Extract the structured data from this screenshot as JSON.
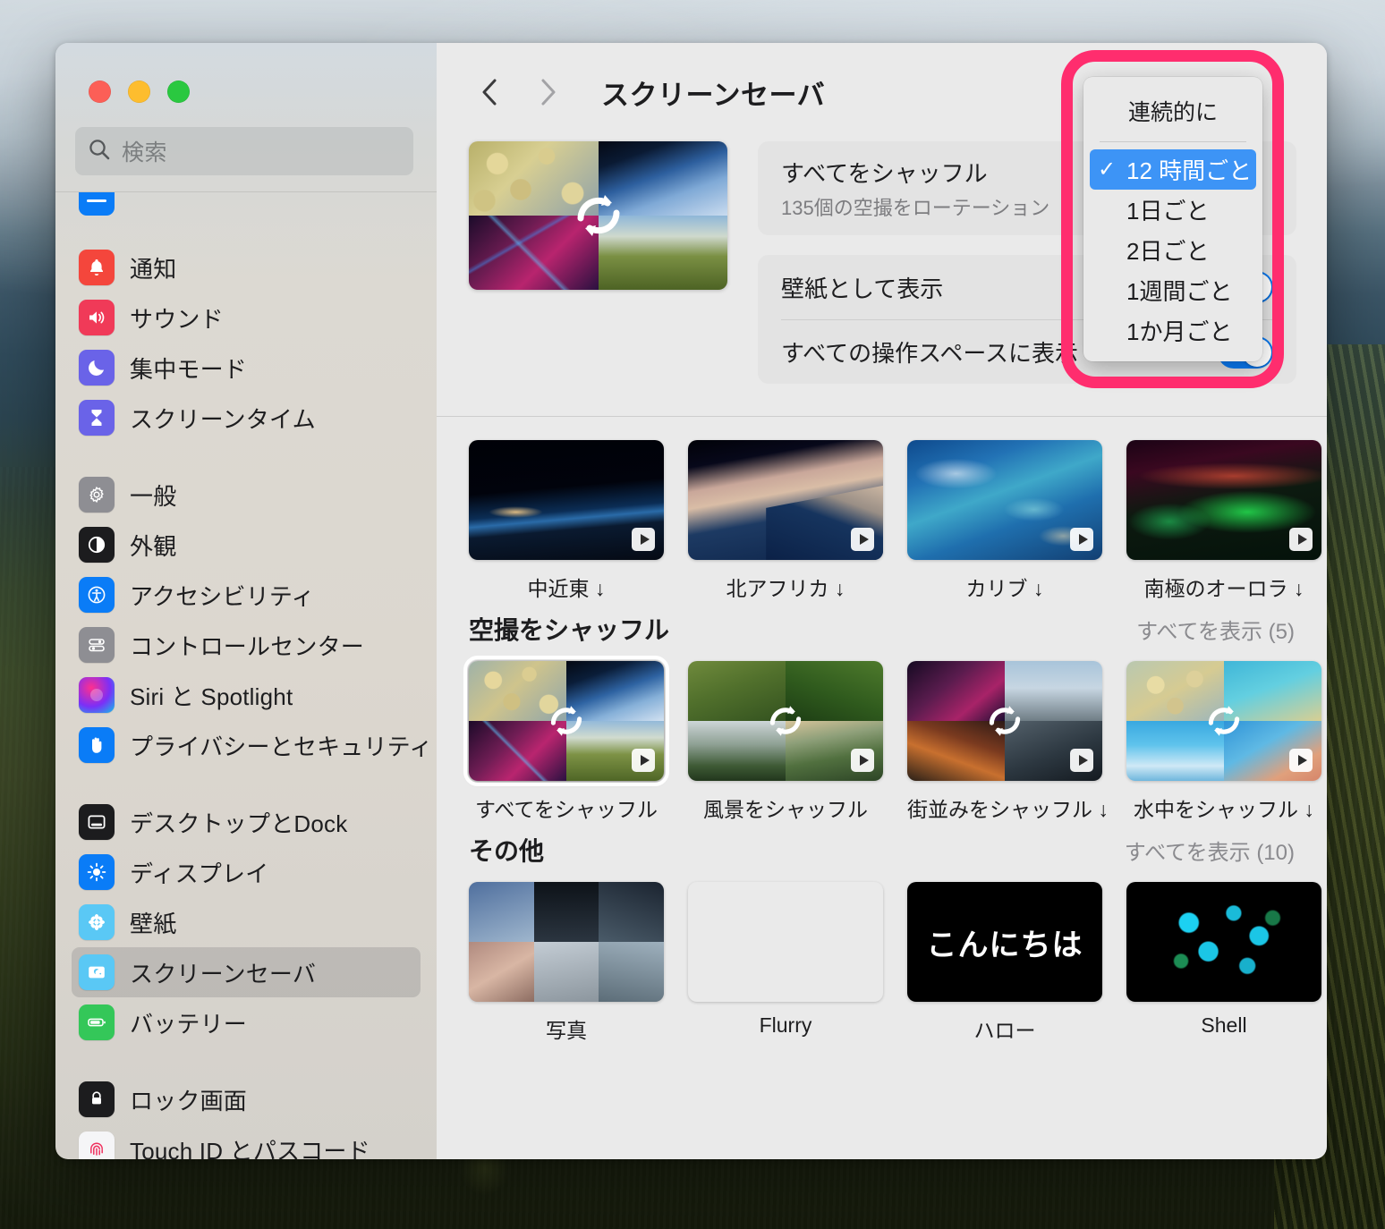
{
  "window": {
    "traffic_lights": [
      "close",
      "minimize",
      "zoom"
    ],
    "title": "スクリーンセーバ"
  },
  "search": {
    "placeholder": "検索",
    "icon": "search-icon"
  },
  "sidebar": {
    "groups": [
      {
        "items": [
          {
            "label": "通知",
            "icon": "bell-icon",
            "color": "#f4463c"
          },
          {
            "label": "サウンド",
            "icon": "speaker-icon",
            "color": "#f03a58"
          },
          {
            "label": "集中モード",
            "icon": "moon-icon",
            "color": "#6a63e8"
          },
          {
            "label": "スクリーンタイム",
            "icon": "hourglass-icon",
            "color": "#6a63e8"
          }
        ]
      },
      {
        "items": [
          {
            "label": "一般",
            "icon": "gear-icon",
            "color": "#8e8e93"
          },
          {
            "label": "外観",
            "icon": "appearance-icon",
            "color": "#1c1c1e"
          },
          {
            "label": "アクセシビリティ",
            "icon": "accessibility-icon",
            "color": "#0a7cf7"
          },
          {
            "label": "コントロールセンター",
            "icon": "sliders-icon",
            "color": "#8e8e93"
          },
          {
            "label": "Siri と Spotlight",
            "icon": "siri-icon",
            "color": "#7b2ff7"
          },
          {
            "label": "プライバシーとセキュリティ",
            "icon": "hand-icon",
            "color": "#0a7cf7"
          }
        ]
      },
      {
        "items": [
          {
            "label": "デスクトップとDock",
            "icon": "desktop-dock-icon",
            "color": "#1c1c1e"
          },
          {
            "label": "ディスプレイ",
            "icon": "brightness-icon",
            "color": "#0a7cf7"
          },
          {
            "label": "壁紙",
            "icon": "wallpaper-icon",
            "color": "#5ac8f5"
          },
          {
            "label": "スクリーンセーバ",
            "icon": "screensaver-icon",
            "color": "#5ac8f5",
            "selected": true
          },
          {
            "label": "バッテリー",
            "icon": "battery-icon",
            "color": "#34c759"
          }
        ]
      },
      {
        "items": [
          {
            "label": "ロック画面",
            "icon": "lock-icon",
            "color": "#1c1c1e"
          },
          {
            "label": "Touch ID とパスコード",
            "icon": "fingerprint-icon",
            "color": "#f5f5f7"
          }
        ]
      }
    ]
  },
  "toolbar": {
    "back_icon": "chevron-left-icon",
    "forward_icon": "chevron-right-icon",
    "title": "スクリーンセーバ"
  },
  "preview": {
    "thumbnail_name": "shuffle-aerials-preview",
    "shuffle_icon": "shuffle-rotate-icon"
  },
  "settings": {
    "rows": [
      {
        "title": "すべてをシャッフル",
        "subtitle": "135個の空撮をローテーション",
        "control": "popup-button",
        "control_value": "12 時間ごと"
      },
      {
        "title": "壁紙として表示",
        "subtitle": "",
        "control": "toggle",
        "control_state": "on"
      },
      {
        "title": "すべての操作スペースに表示",
        "subtitle": "",
        "control": "toggle",
        "control_state": "on"
      }
    ]
  },
  "popup_menu": {
    "header": "連続的に",
    "selected": "12 時間ごと",
    "check_glyph": "✓",
    "items": [
      {
        "label": "12 時間ごと",
        "selected": true
      },
      {
        "label": "1日ごと",
        "selected": false
      },
      {
        "label": "2日ごと",
        "selected": false
      },
      {
        "label": "1週間ごと",
        "selected": false
      },
      {
        "label": "1か月ごと",
        "selected": false
      }
    ]
  },
  "highlight": {
    "color": "#ff2d6e",
    "target": "popup-menu"
  },
  "gallery": {
    "sections": [
      {
        "title": "",
        "show_all": "",
        "tiles": [
          {
            "label": "中近東 ↓",
            "art": "art-mideast",
            "has_play": true,
            "selected": false
          },
          {
            "label": "北アフリカ ↓",
            "art": "art-nafrica",
            "has_play": true,
            "selected": false
          },
          {
            "label": "カリブ ↓",
            "art": "art-carib",
            "has_play": true,
            "selected": false
          },
          {
            "label": "南極のオーロラ ↓",
            "art": "art-aurora",
            "has_play": true,
            "selected": false
          },
          {
            "label": "",
            "art": "art-edge-space",
            "has_play": false,
            "selected": false,
            "clipped": true
          }
        ]
      },
      {
        "title": "空撮をシャッフル",
        "show_all": "すべてを表示 (5)",
        "tiles": [
          {
            "label": "すべてをシャッフル",
            "art": "quad-all",
            "has_play": true,
            "selected": true
          },
          {
            "label": "風景をシャッフル",
            "art": "quad-landscape",
            "has_play": true,
            "selected": false
          },
          {
            "label": "街並みをシャッフル ↓",
            "art": "quad-city",
            "has_play": true,
            "selected": false
          },
          {
            "label": "水中をシャッフル ↓",
            "art": "quad-underwater",
            "has_play": true,
            "selected": false
          },
          {
            "label": "",
            "art": "art-vine",
            "has_play": false,
            "selected": false,
            "clipped": true
          }
        ]
      },
      {
        "title": "その他",
        "show_all": "すべてを表示 (10)",
        "tiles": [
          {
            "label": "写真",
            "art": "art-photos",
            "has_play": false,
            "selected": false
          },
          {
            "label": "Flurry",
            "art": "art-flurry",
            "has_play": false,
            "selected": false
          },
          {
            "label": "ハロー",
            "art": "art-hello",
            "art_text": "こんにちは",
            "has_play": false,
            "selected": false
          },
          {
            "label": "Shell",
            "art": "art-shell",
            "has_play": false,
            "selected": false
          },
          {
            "label": "",
            "art": "art-fingerp",
            "has_play": false,
            "selected": false,
            "clipped": true
          }
        ]
      }
    ]
  }
}
